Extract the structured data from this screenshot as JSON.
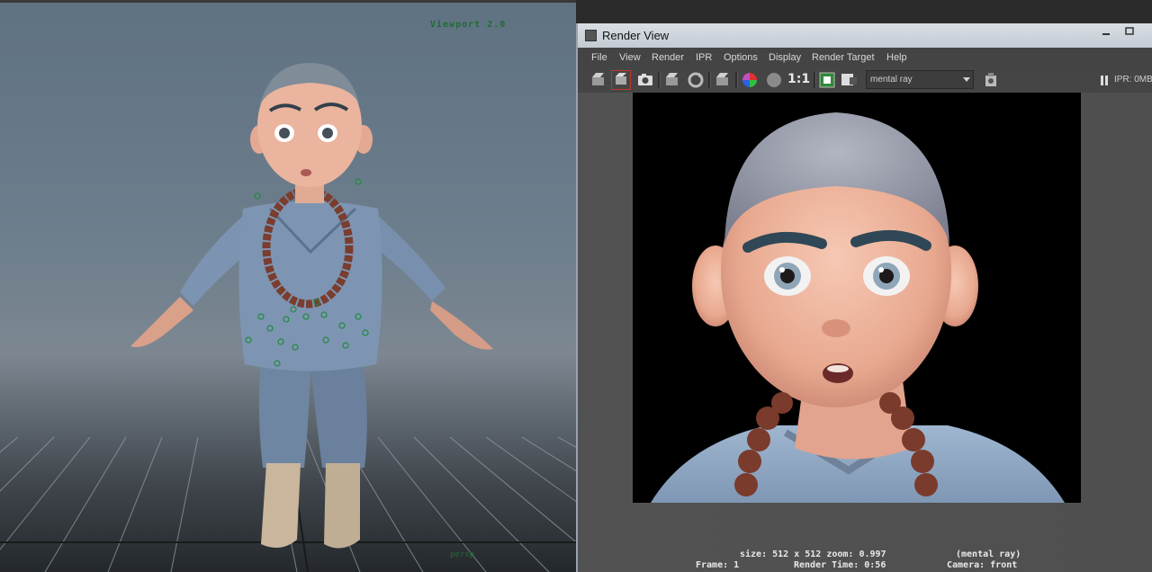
{
  "viewport": {
    "label": "Viewport 2.0",
    "camera_tag": "persp"
  },
  "render_view": {
    "title": "Render View",
    "window_buttons": [
      "minimize",
      "maximize"
    ],
    "menu": [
      "File",
      "View",
      "Render",
      "IPR",
      "Options",
      "Display",
      "Render Target",
      "Help"
    ],
    "toolbar_icons": [
      "redo-render-icon",
      "render-region-icon",
      "snapshot-icon",
      "ipr-render-icon",
      "refresh-icon",
      "render-sequence-icon",
      "color-channels-icon",
      "alpha-icon",
      "real-size-icon",
      "keep-image-icon",
      "remove-image-icon",
      "render-settings-icon"
    ],
    "one_to_one_label": "1:1",
    "renderer": "mental ray",
    "ipr_status": "IPR: 0MB",
    "status": {
      "size_zoom": "size: 512 x 512 zoom: 0.997",
      "renderer": "(mental ray)",
      "frame": "Frame: 1",
      "render_time": "Render Time: 0:56",
      "camera": "Camera: front"
    }
  }
}
